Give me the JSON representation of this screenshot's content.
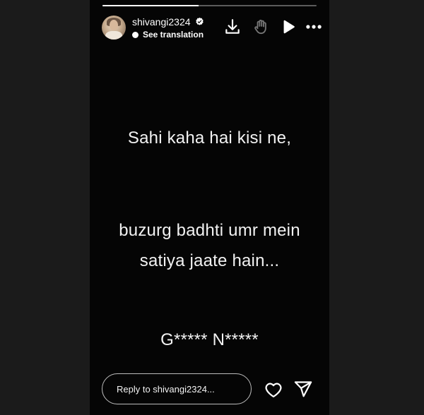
{
  "story": {
    "progress_fraction": 0.45,
    "username": "shivangi2324",
    "translation_label": "See translation",
    "lines": [
      "Sahi kaha hai kisi ne,",
      "buzurg badhti umr mein",
      "satiya jaate hain...",
      "G***** N*****"
    ],
    "reply_placeholder": "Reply to shivangi2324..."
  },
  "icons": {
    "verified": "verified-badge-icon",
    "download": "download-icon",
    "hand": "hand-icon",
    "play": "play-icon",
    "more": "more-horizontal-icon",
    "heart": "heart-icon",
    "send": "send-icon"
  },
  "colors": {
    "story_background": "#050505",
    "page_background": "#1b1b1b",
    "text": "#f2f2f2"
  }
}
